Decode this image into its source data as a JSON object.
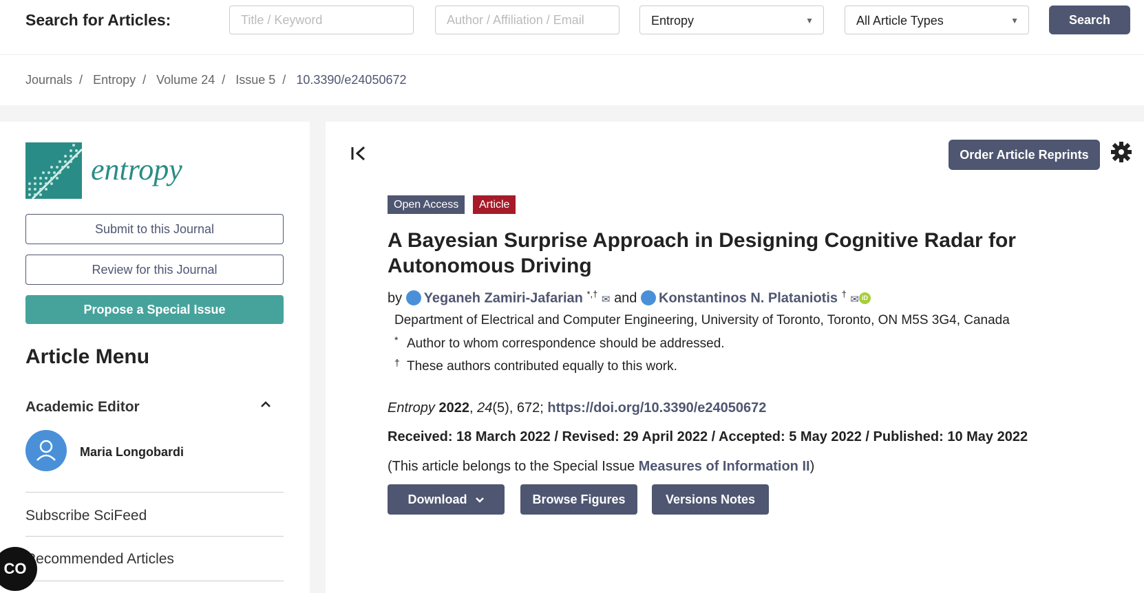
{
  "search": {
    "title": "Search for Articles:",
    "keyword_placeholder": "Title / Keyword",
    "author_placeholder": "Author / Affiliation / Email",
    "journal_selected": "Entropy",
    "type_selected": "All Article Types",
    "button_label": "Search"
  },
  "breadcrumb": [
    "Journals",
    "Entropy",
    "Volume 24",
    "Issue 5",
    "10.3390/e24050672"
  ],
  "sidebar": {
    "journal_name": "entropy",
    "submit_label": "Submit to this Journal",
    "review_label": "Review for this Journal",
    "propose_label": "Propose a Special Issue",
    "menu_title": "Article Menu",
    "academic_editor_label": "Academic Editor",
    "editor_name": "Maria Longobardi",
    "links": [
      "Subscribe SciFeed",
      "Recommended Articles"
    ],
    "cookie_badge": "CO"
  },
  "article": {
    "reprints_label": "Order Article Reprints",
    "badge_open_access": "Open Access",
    "badge_type": "Article",
    "title": "A Bayesian Surprise Approach in Designing Cognitive Radar for Autonomous Driving",
    "by": "by",
    "author1": "Yeganeh Zamiri-Jafarian",
    "author1_marks": "*,†",
    "and": "and",
    "author2": "Konstantinos N. Plataniotis",
    "author2_marks": "†",
    "affiliation": "Department of Electrical and Computer Engineering, University of Toronto, Toronto, ON M5S 3G4, Canada",
    "note1_mark": "*",
    "note1": "Author to whom correspondence should be addressed.",
    "note2_mark": "†",
    "note2": "These authors contributed equally to this work.",
    "citation_journal": "Entropy",
    "citation_year": "2022",
    "citation_volume": "24",
    "citation_rest": "(5), 672;",
    "doi": "https://doi.org/10.3390/e24050672",
    "dates": "Received: 18 March 2022 / Revised: 29 April 2022 / Accepted: 5 May 2022 / Published: 10 May 2022",
    "special_prefix": "(This article belongs to the Special Issue",
    "special_issue": "Measures of Information II",
    "special_suffix": ")",
    "download_label": "Download",
    "figures_label": "Browse Figures",
    "versions_label": "Versions Notes"
  },
  "colors": {
    "brand_dark": "#4f5671",
    "teal": "#46a39c",
    "article_red": "#a61b29"
  }
}
